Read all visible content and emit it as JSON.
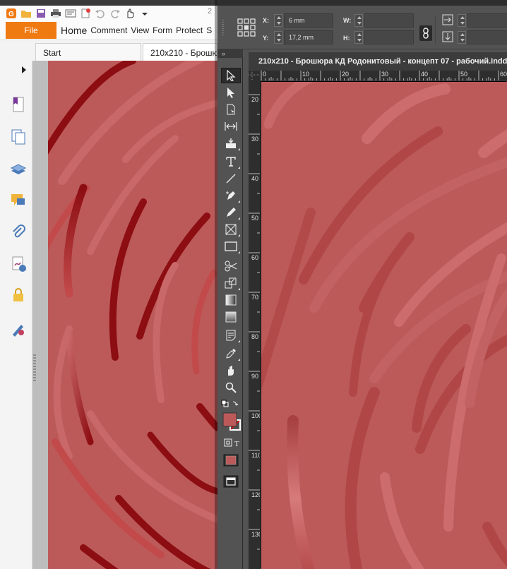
{
  "foxit": {
    "title_fragment": "2",
    "file_label": "File",
    "menu": [
      "Home",
      "Comment",
      "View",
      "Form",
      "Protect",
      "S"
    ],
    "tabs": [
      {
        "label": "Start"
      },
      {
        "label": "210x210 - Брошю"
      }
    ],
    "accent_color": "#f07a12"
  },
  "indesign": {
    "control": {
      "x_label": "X:",
      "x_value": "6 mm",
      "y_label": "Y:",
      "y_value": "17,2 mm",
      "w_label": "W:",
      "h_label": "H:"
    },
    "doc_title": "210x210 - Брошюра КД Родонитовый - концепт 07 - рабочий.indd",
    "ruler_h": [
      "0",
      "10",
      "20",
      "30",
      "40",
      "50",
      "60"
    ],
    "ruler_v": [
      "20",
      "30",
      "40",
      "50",
      "60",
      "70",
      "80",
      "90",
      "100",
      "110",
      "120",
      "130"
    ],
    "tools_header": "»",
    "swatch_color": "#bc5a5a"
  },
  "artwork_color": "#bc5a5a"
}
